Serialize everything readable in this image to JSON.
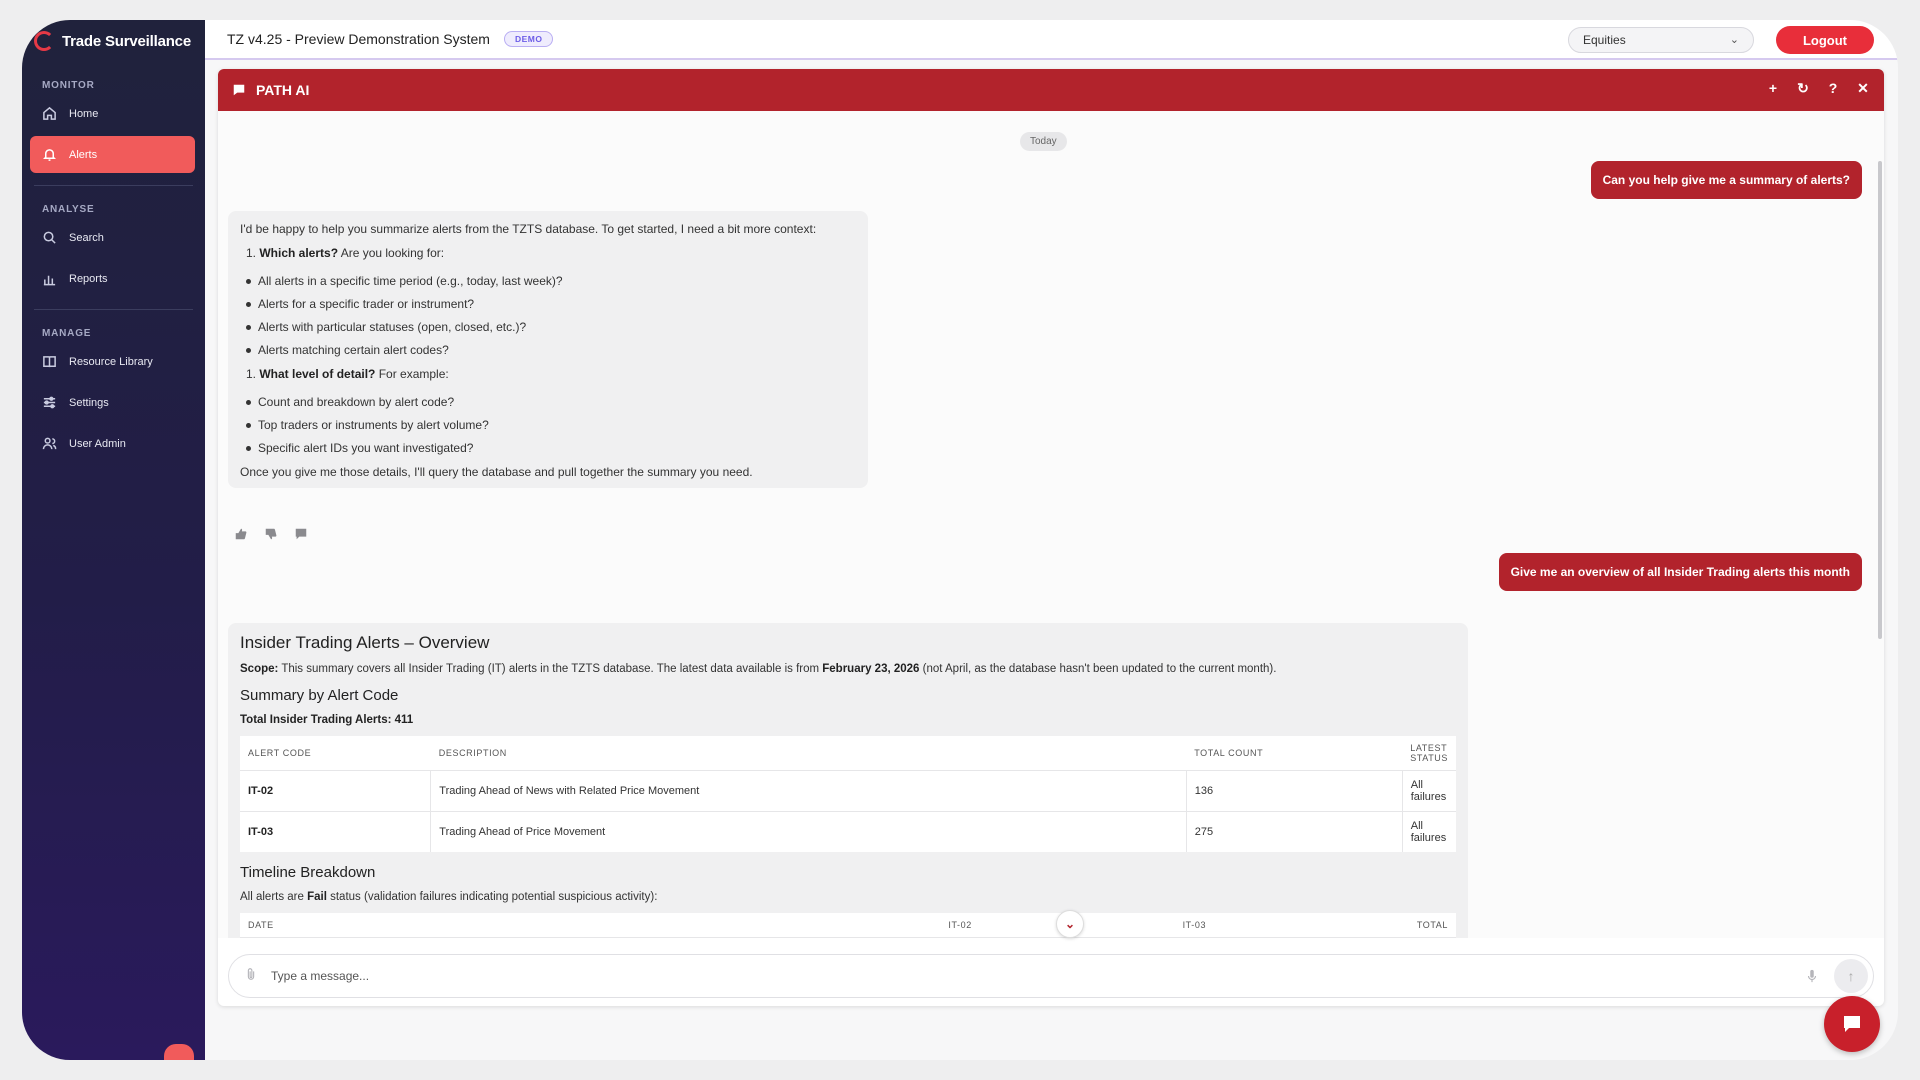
{
  "app": {
    "brand": "Trade Surveillance",
    "system_title": "TZ v4.25 - Preview Demonstration System",
    "badge": "DEMO"
  },
  "header": {
    "market": "Equities",
    "logout": "Logout"
  },
  "sidebar": {
    "sections": [
      {
        "title": "MONITOR",
        "items": [
          {
            "label": "Home",
            "icon": "home-icon"
          },
          {
            "label": "Alerts",
            "icon": "bell-icon",
            "active": true
          }
        ]
      },
      {
        "title": "ANALYSE",
        "items": [
          {
            "label": "Search",
            "icon": "search-icon"
          },
          {
            "label": "Reports",
            "icon": "bar-chart-icon"
          }
        ]
      },
      {
        "title": "MANAGE",
        "items": [
          {
            "label": "Resource Library",
            "icon": "book-icon"
          },
          {
            "label": "Settings",
            "icon": "sliders-icon"
          },
          {
            "label": "User Admin",
            "icon": "users-icon"
          }
        ]
      }
    ]
  },
  "chat": {
    "title": "PATH AI",
    "date_label": "Today",
    "user_msg_1": "Can you help give me a summary of alerts?",
    "ai_msg_1": {
      "intro": "I'd be happy to help you summarize alerts from the TZTS database. To get started, I need a bit more context:",
      "q1_title": "Which alerts?",
      "q1_rest": " Are you looking for:",
      "q1_items": [
        "All alerts in a specific time period (e.g., today, last week)?",
        "Alerts for a specific trader or instrument?",
        "Alerts with particular statuses (open, closed, etc.)?",
        "Alerts matching certain alert codes?"
      ],
      "q2_title": "What level of detail?",
      "q2_rest": " For example:",
      "q2_items": [
        "Count and breakdown by alert code?",
        "Top traders or instruments by alert volume?",
        "Specific alert IDs you want investigated?"
      ],
      "outro": "Once you give me those details, I'll query the database and pull together the summary you need."
    },
    "user_msg_2": "Give me an overview of all Insider Trading alerts this month",
    "report": {
      "title": "Insider Trading Alerts – Overview",
      "scope_label": "Scope:",
      "scope_text": " This summary covers all Insider Trading (IT) alerts in the TZTS database. The latest data available is from ",
      "scope_date": "February 23, 2026",
      "scope_tail": " (not April, as the database hasn't been updated to the current month).",
      "summary_heading": "Summary by Alert Code",
      "total_line": "Total Insider Trading Alerts: 411",
      "table_headers": [
        "ALERT CODE",
        "DESCRIPTION",
        "TOTAL COUNT",
        "LATEST STATUS"
      ],
      "rows": [
        {
          "code": "IT-02",
          "description": "Trading Ahead of News with Related Price Movement",
          "count": "136",
          "status": "All failures"
        },
        {
          "code": "IT-03",
          "description": "Trading Ahead of Price Movement",
          "count": "275",
          "status": "All failures"
        }
      ],
      "timeline_heading": "Timeline Breakdown",
      "timeline_pre": "All alerts are ",
      "timeline_bold": "Fail",
      "timeline_post": " status (validation failures indicating potential suspicious activity):",
      "timeline_headers": [
        "DATE",
        "IT-02",
        "IT-03",
        "TOTAL"
      ]
    },
    "input_placeholder": "Type a message..."
  }
}
